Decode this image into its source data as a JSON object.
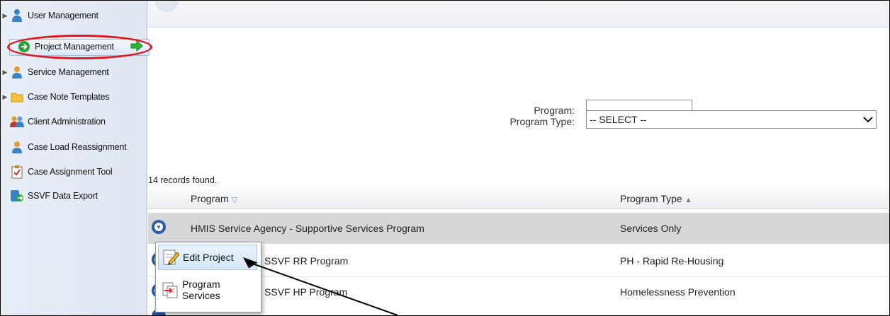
{
  "sidebar": {
    "items": [
      {
        "label": "User Management",
        "icon": "user-icon",
        "expandable": true
      },
      {
        "label": "Project Management",
        "icon": "green-arrow-circle-icon",
        "expandable": false,
        "selected": true
      },
      {
        "label": "Service Management",
        "icon": "service-user-icon",
        "expandable": true
      },
      {
        "label": "Case Note Templates",
        "icon": "folder-icon",
        "expandable": true
      },
      {
        "label": "Client Administration",
        "icon": "users-group-icon",
        "expandable": false
      },
      {
        "label": "Case Load Reassignment",
        "icon": "reassign-user-icon",
        "expandable": false
      },
      {
        "label": "Case Assignment Tool",
        "icon": "clipboard-check-icon",
        "expandable": false
      },
      {
        "label": "SSVF Data Export",
        "icon": "export-icon",
        "expandable": false
      }
    ]
  },
  "filters": {
    "program_label": "Program:",
    "program_value": "",
    "program_type_label": "Program Type:",
    "program_type_value": "-- SELECT --"
  },
  "results": {
    "count_text": "14 records found.",
    "columns": {
      "program": "Program",
      "program_type": "Program Type"
    },
    "rows": [
      {
        "program": "HMIS Service Agency - Supportive Services Program",
        "program_type": "Services Only"
      },
      {
        "program": "ency - SSVF RR Program",
        "program_type": "PH - Rapid Re-Housing"
      },
      {
        "program": "ency - SSVF HP Program",
        "program_type": "Homelessness Prevention"
      }
    ]
  },
  "context_menu": {
    "items": [
      {
        "label": "Edit Project",
        "icon": "edit-pencil-icon"
      },
      {
        "label": "Program Services",
        "icon": "services-doc-icon"
      }
    ]
  },
  "colors": {
    "annotation_red": "#e0141b",
    "row_highlight": "#d6d7d9",
    "accent_blue": "#2a5aa8"
  }
}
